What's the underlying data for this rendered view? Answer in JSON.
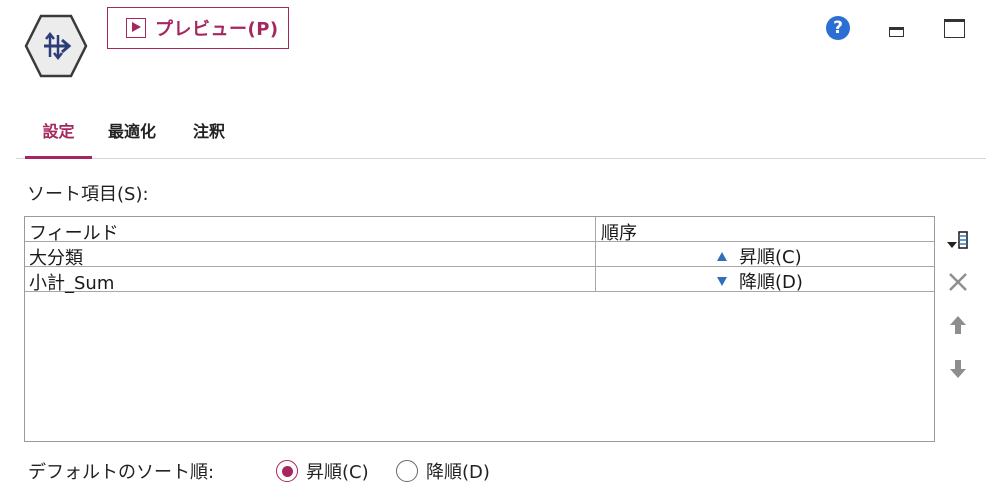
{
  "header": {
    "node_icon": "sort-node-icon",
    "preview_button": {
      "label": "プレビュー(P)",
      "icon": "play-icon"
    },
    "window_controls": {
      "help_icon": "?",
      "help": "help-icon",
      "minimize": "minimize-icon",
      "maximize": "maximize-icon"
    }
  },
  "tabs": [
    {
      "label": "設定",
      "active": true
    },
    {
      "label": "最適化",
      "active": false
    },
    {
      "label": "注釈",
      "active": false
    }
  ],
  "sort_fields": {
    "label": "ソート項目(S):",
    "columns": {
      "field": "フィールド",
      "order": "順序"
    },
    "rows": [
      {
        "field": "大分類",
        "order": "昇順(C)",
        "direction": "ascending"
      },
      {
        "field": "小計_Sum",
        "order": "降順(D)",
        "direction": "descending"
      }
    ]
  },
  "side_buttons": [
    "add-field-icon",
    "delete-icon",
    "move-up-icon",
    "move-down-icon"
  ],
  "default_order": {
    "label": "デフォルトのソート順:",
    "options": [
      {
        "label": "昇順(C)",
        "checked": true
      },
      {
        "label": "降順(D)",
        "checked": false
      }
    ]
  },
  "colors": {
    "accent": "#a4275f",
    "help": "#2b6fd2",
    "triangle": "#2f70b8"
  }
}
